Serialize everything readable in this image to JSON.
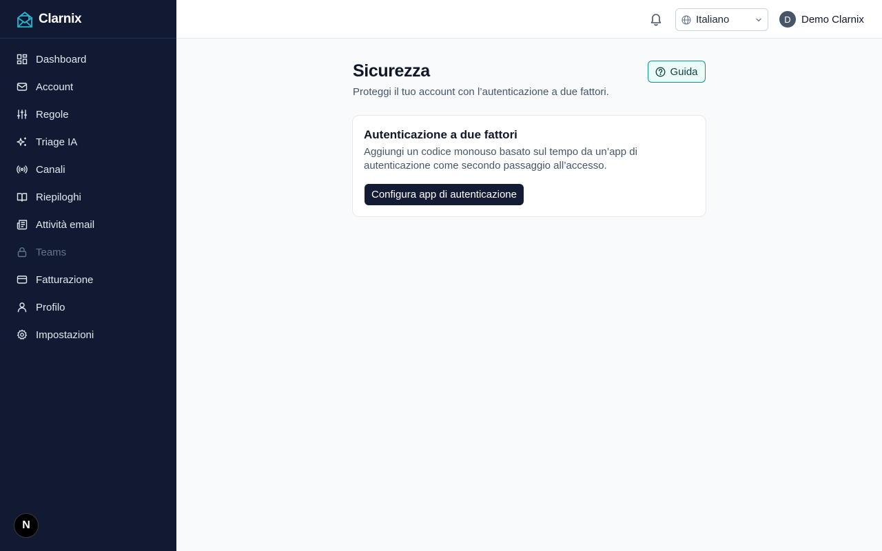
{
  "brand": {
    "name": "Clarnix",
    "icon": "mail-open-icon",
    "accent": "#22b8cf"
  },
  "sidebar": {
    "items": [
      {
        "label": "Dashboard",
        "icon": "layout-dashboard-icon",
        "disabled": false
      },
      {
        "label": "Account",
        "icon": "mail-icon",
        "disabled": false
      },
      {
        "label": "Regole",
        "icon": "sliders-icon",
        "disabled": false
      },
      {
        "label": "Triage IA",
        "icon": "sparkles-icon",
        "disabled": false
      },
      {
        "label": "Canali",
        "icon": "radio-icon",
        "disabled": false
      },
      {
        "label": "Riepiloghi",
        "icon": "book-open-icon",
        "disabled": false
      },
      {
        "label": "Attività email",
        "icon": "newspaper-icon",
        "disabled": false
      },
      {
        "label": "Teams",
        "icon": "lock-icon",
        "disabled": true
      },
      {
        "label": "Fatturazione",
        "icon": "credit-card-icon",
        "disabled": false
      },
      {
        "label": "Profilo",
        "icon": "user-icon",
        "disabled": false
      },
      {
        "label": "Impostazioni",
        "icon": "gear-icon",
        "disabled": false
      }
    ],
    "footer_badge": "N"
  },
  "header": {
    "notification_icon": "bell-icon",
    "language": {
      "selected": "Italiano",
      "icon": "globe-icon"
    },
    "user": {
      "initial": "D",
      "name": "Demo Clarnix"
    }
  },
  "main": {
    "title": "Sicurezza",
    "subtitle": "Proteggi il tuo account con l’autenticazione a due fattori.",
    "guide_label": "Guida",
    "card": {
      "title": "Autenticazione a due fattori",
      "description": "Aggiungi un codice monouso basato sul tempo da un’app di autenticazione come secondo passaggio all’accesso.",
      "button_label": "Configura app di autenticazione"
    }
  },
  "colors": {
    "sidebar_bg": "#121a33",
    "guide_border": "#0d9488",
    "primary_button": "#141b34"
  }
}
